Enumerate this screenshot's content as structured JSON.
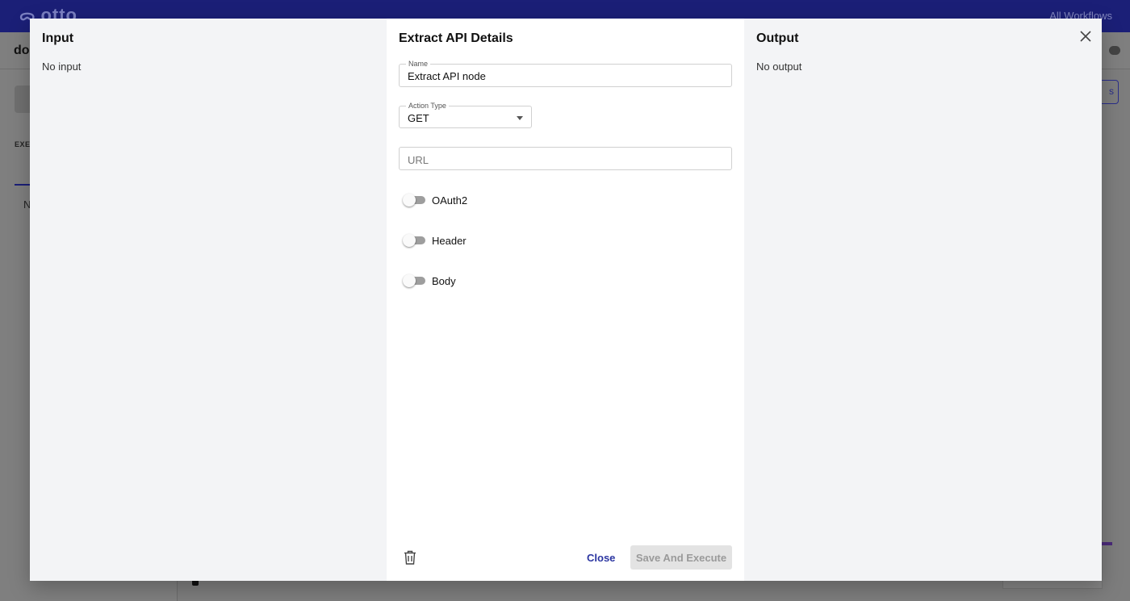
{
  "background": {
    "logo_text": "otto",
    "all_workflows": "All Workflows",
    "title_partial": "do",
    "section_partial": "EXEC",
    "list_partial": "N",
    "button_partial": "s"
  },
  "modal": {
    "input_panel": {
      "title": "Input",
      "empty_text": "No input"
    },
    "details_panel": {
      "title": "Extract API Details",
      "name_field": {
        "label": "Name",
        "value": "Extract API node"
      },
      "action_type": {
        "label": "Action Type",
        "value": "GET"
      },
      "url_field": {
        "placeholder": "URL"
      },
      "toggles": [
        {
          "label": "OAuth2",
          "on": false
        },
        {
          "label": "Header",
          "on": false
        },
        {
          "label": "Body",
          "on": false
        }
      ],
      "close_label": "Close",
      "save_label": "Save And Execute"
    },
    "output_panel": {
      "title": "Output",
      "empty_text": "No output"
    }
  },
  "colors": {
    "brand": "#1b1f77",
    "link": "#2b35a1",
    "disabled_button": "#e3e3e3"
  },
  "icons": [
    "otto-logo-icon",
    "close-icon",
    "trash-icon",
    "caret-down-icon"
  ]
}
